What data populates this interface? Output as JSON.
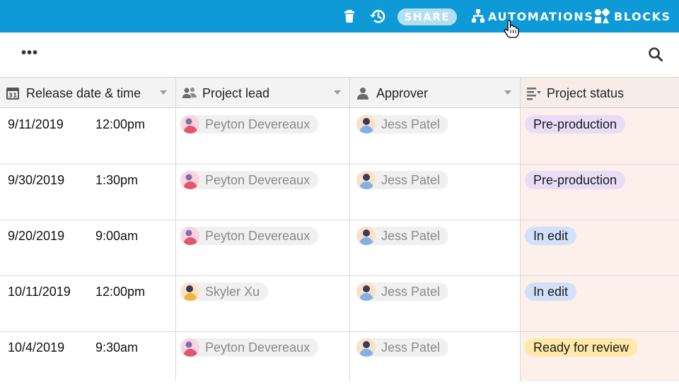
{
  "topbar": {
    "share_label": "SHARE",
    "automations_label": "AUTOMATIONS",
    "blocks_label": "BLOCKS",
    "bg_color": "#0d9ad6"
  },
  "toolbar": {
    "more_label": "•••"
  },
  "columns": {
    "release": {
      "label": "Release date & time",
      "icon": "calendar-icon",
      "icon_text": "31"
    },
    "lead": {
      "label": "Project lead",
      "icon": "users-icon"
    },
    "approver": {
      "label": "Approver",
      "icon": "user-icon"
    },
    "status": {
      "label": "Project status",
      "icon": "single-select-icon"
    }
  },
  "rows": [
    {
      "date": "9/11/2019",
      "time": "12:00pm",
      "lead": "Peyton Devereaux",
      "approver": "Jess Patel",
      "status": "Pre-production"
    },
    {
      "date": "9/30/2019",
      "time": "1:30pm",
      "lead": "Peyton Devereaux",
      "approver": "Jess Patel",
      "status": "Pre-production"
    },
    {
      "date": "9/20/2019",
      "time": "9:00am",
      "lead": "Peyton Devereaux",
      "approver": "Jess Patel",
      "status": "In edit"
    },
    {
      "date": "10/11/2019",
      "time": "12:00pm",
      "lead": "Skyler Xu",
      "approver": "Jess Patel",
      "status": "In edit"
    },
    {
      "date": "10/4/2019",
      "time": "9:30am",
      "lead": "Peyton Devereaux",
      "approver": "Jess Patel",
      "status": "Ready for review"
    }
  ],
  "status_colors": {
    "Pre-production": "#e8dcf7",
    "In edit": "#d1e1fa",
    "Ready for review": "#fde9a8"
  }
}
